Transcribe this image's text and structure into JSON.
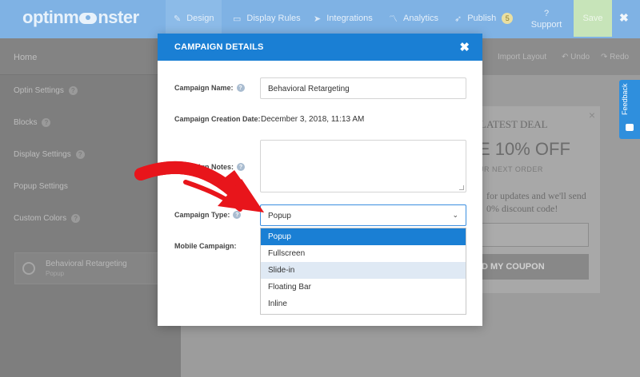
{
  "app": {
    "logo_text_1": "optinm",
    "logo_text_2": "nster"
  },
  "topnav": {
    "tabs": [
      {
        "label": "Design",
        "icon": "pencil-icon"
      },
      {
        "label": "Display Rules",
        "icon": "monitor-icon"
      },
      {
        "label": "Integrations",
        "icon": "paper-plane-icon"
      },
      {
        "label": "Analytics",
        "icon": "line-chart-icon"
      },
      {
        "label": "Publish",
        "icon": "rocket-icon",
        "badge": "5"
      }
    ],
    "support_icon": "?",
    "support_label": "Support",
    "save_label": "Save",
    "close_icon": "✖"
  },
  "sidebar": {
    "home_label": "Home",
    "items": [
      {
        "label": "Optin Settings"
      },
      {
        "label": "Blocks"
      },
      {
        "label": "Display Settings"
      },
      {
        "label": "Popup Settings"
      },
      {
        "label": "Custom Colors"
      }
    ],
    "campaign_card": {
      "title": "Behavioral Retargeting",
      "subtitle": "Popup"
    }
  },
  "toolbar": {
    "import_label": "Import Layout",
    "undo_label": "Undo",
    "redo_label": "Redo"
  },
  "preview": {
    "latest_text": "LATEST DEAL",
    "off_text": "E 10% OFF",
    "order_text": "UR NEXT ORDER",
    "updates_line1": "for updates and we'll send",
    "updates_line2": "0% discount code!",
    "coupon_text": "D MY COUPON",
    "close_icon": "×"
  },
  "feedback": {
    "label": "Feedback"
  },
  "modal": {
    "title": "CAMPAIGN DETAILS",
    "close_icon": "✖",
    "labels": {
      "name": "Campaign Name:",
      "date": "Campaign Creation Date:",
      "notes": "Campaign Notes:",
      "type": "Campaign Type:",
      "mobile": "Mobile Campaign:"
    },
    "name_value": "Behavioral Retargeting",
    "creation_date": "December 3, 2018, 11:13 AM",
    "notes_value": "",
    "type_value": "Popup",
    "type_options": [
      "Popup",
      "Fullscreen",
      "Slide-in",
      "Floating Bar",
      "Inline"
    ],
    "selected_option": "Popup",
    "hovered_option": "Slide-in"
  },
  "colors": {
    "modal_header": "#1a7fd4",
    "arrow": "#e8151b",
    "feedback_tab": "#2f8fdd"
  }
}
